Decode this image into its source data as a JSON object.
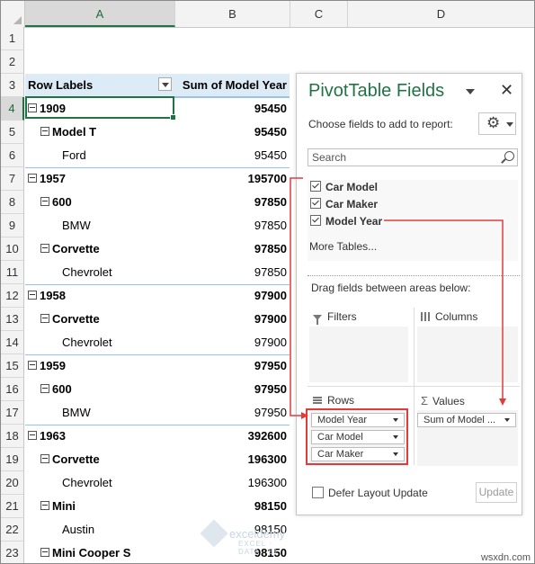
{
  "columns": [
    "A",
    "B",
    "C",
    "D"
  ],
  "row_numbers": [
    "1",
    "2",
    "3",
    "4",
    "5",
    "6",
    "7",
    "8",
    "9",
    "10",
    "11",
    "12",
    "13",
    "14",
    "15",
    "16",
    "17",
    "18",
    "19",
    "20",
    "21",
    "22",
    "23"
  ],
  "header": {
    "row_labels": "Row Labels",
    "sum_label": "Sum of Model Year"
  },
  "pivot_rows": [
    {
      "label": "1909",
      "value": "95450",
      "level": "year"
    },
    {
      "label": "Model T",
      "value": "95450",
      "level": "model"
    },
    {
      "label": "Ford",
      "value": "95450",
      "level": "maker"
    },
    {
      "label": "1957",
      "value": "195700",
      "level": "year"
    },
    {
      "label": "600",
      "value": "97850",
      "level": "model"
    },
    {
      "label": "BMW",
      "value": "97850",
      "level": "maker"
    },
    {
      "label": "Corvette",
      "value": "97850",
      "level": "model"
    },
    {
      "label": "Chevrolet",
      "value": "97850",
      "level": "maker"
    },
    {
      "label": "1958",
      "value": "97900",
      "level": "year"
    },
    {
      "label": "Corvette",
      "value": "97900",
      "level": "model"
    },
    {
      "label": "Chevrolet",
      "value": "97900",
      "level": "maker"
    },
    {
      "label": "1959",
      "value": "97950",
      "level": "year"
    },
    {
      "label": "600",
      "value": "97950",
      "level": "model"
    },
    {
      "label": "BMW",
      "value": "97950",
      "level": "maker"
    },
    {
      "label": "1963",
      "value": "392600",
      "level": "year"
    },
    {
      "label": "Corvette",
      "value": "196300",
      "level": "model"
    },
    {
      "label": "Chevrolet",
      "value": "196300",
      "level": "maker"
    },
    {
      "label": "Mini",
      "value": "98150",
      "level": "model"
    },
    {
      "label": "Austin",
      "value": "98150",
      "level": "maker"
    },
    {
      "label": "Mini Cooper S",
      "value": "98150",
      "level": "model"
    }
  ],
  "pane": {
    "title": "PivotTable Fields",
    "close": "✕",
    "choose_label": "Choose fields to add to report:",
    "gear_icon": "⚙",
    "search_placeholder": "Search",
    "fields": [
      {
        "label": "Car Model",
        "checked": true
      },
      {
        "label": "Car Maker",
        "checked": true
      },
      {
        "label": "Model Year",
        "checked": true
      }
    ],
    "more_tables": "More Tables...",
    "drag_label": "Drag fields between areas below:",
    "areas": {
      "filters": "Filters",
      "columns": "Columns",
      "rows": "Rows",
      "values": "Values"
    },
    "rows_items": [
      "Model Year",
      "Car Model",
      "Car Maker"
    ],
    "values_items": [
      "Sum of Model ..."
    ],
    "defer_label": "Defer Layout Update",
    "update_label": "Update"
  },
  "watermark": {
    "name": "exceldemy",
    "tagline": "EXCEL · DATA · BI"
  },
  "credit": "wsxdn.com",
  "colors": {
    "accent_green": "#217346",
    "annotation_red": "#e03c3c",
    "header_blue": "#ddebf7"
  }
}
